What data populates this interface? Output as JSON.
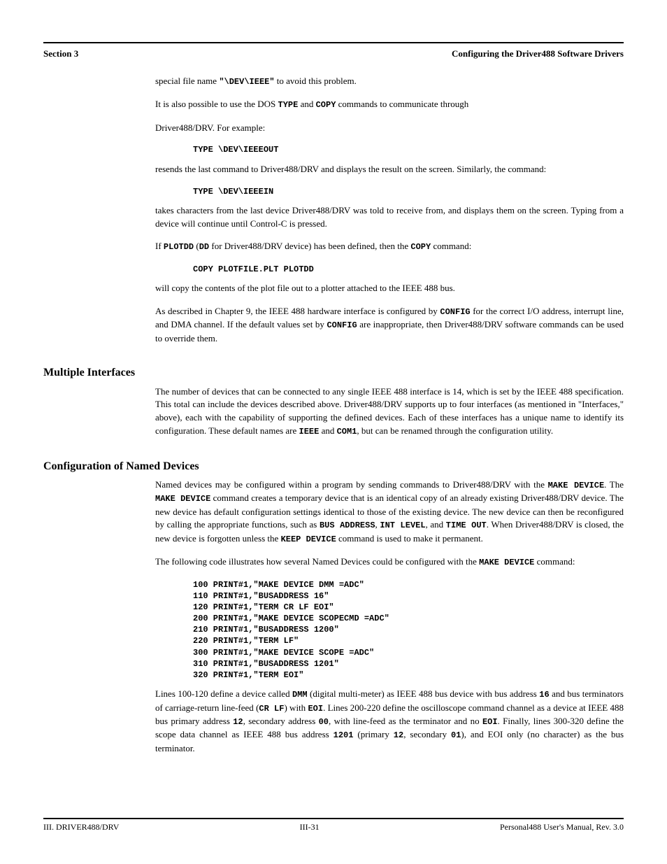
{
  "header": {
    "left": "Section 3",
    "right": "Configuring the Driver488 Software Drivers"
  },
  "p1": {
    "t1": "special file name ",
    "m1": "\"\\DEV\\IEEE\"",
    "t2": " to avoid this problem."
  },
  "p2": {
    "t1": "It is also possible to use the DOS ",
    "m1": "TYPE",
    "t2": " and ",
    "m2": "COPY",
    "t3": " commands to communicate through"
  },
  "p3": "Driver488/DRV. For example:",
  "code1": "TYPE \\DEV\\IEEEOUT",
  "p4": "resends the last command to Driver488/DRV and displays the result on the screen. Similarly, the command:",
  "code2": "TYPE \\DEV\\IEEEIN",
  "p5": "takes characters from the last device Driver488/DRV was told to receive from, and displays them on the screen. Typing from a device will continue until Control-C is pressed.",
  "p6": {
    "t1": "If ",
    "m1": "PLOTDD",
    "t2": " (",
    "m2": "DD",
    "t3": " for Driver488/DRV device) has been defined, then the ",
    "m3": "COPY",
    "t4": " command:"
  },
  "code3": "COPY PLOTFILE.PLT PLOTDD",
  "p7": "will copy the contents of the plot file out to a plotter attached to the IEEE 488 bus.",
  "p8": {
    "t1": "As described in Chapter 9, the IEEE 488 hardware interface is configured by ",
    "m1": "CONFIG",
    "t2": " for the correct I/O address, interrupt line, and DMA channel. If the default values set by ",
    "m2": "CONFIG",
    "t3": " are inappropriate, then Driver488/DRV software commands can be used to override them."
  },
  "h3": "Multiple Interfaces",
  "p9": {
    "t1": "The number of devices that can be connected to any single IEEE 488 interface is 14, which is set by the IEEE 488 specification. This total can include the devices described above. Driver488/DRV supports up to four interfaces (as mentioned in \"Interfaces,\" above), each with the capability of supporting the defined devices. Each of these interfaces has a unique name to identify its configuration. These default names are ",
    "m1": "IEEE",
    "t2": " and ",
    "m2": "COM1",
    "t3": ", but can be renamed through the configuration utility."
  },
  "h4": "Configuration of Named Devices",
  "p10": {
    "t1": "Named devices may be configured within a program by sending commands to Driver488/DRV with the ",
    "m1": "MAKE DEVICE",
    "t2": ". The ",
    "m2": "MAKE DEVICE",
    "t3": " command creates a temporary device that is an identical copy of an already existing Driver488/DRV device. The new device has default configuration settings identical to those of the existing device. The new device can then be reconfigured by calling the appropriate functions, such as ",
    "m3": "BUS ADDRESS",
    "t4": ", ",
    "m4": "INT LEVEL",
    "t5": ", and ",
    "m5": "TIME OUT",
    "t6": ". When Driver488/DRV is closed, the new device is forgotten unless the ",
    "m6": "KEEP DEVICE",
    "t7": " command is used to make it permanent."
  },
  "p11": {
    "t1": "The following code illustrates how several Named Devices could be configured with the ",
    "m1": "MAKE DEVICE",
    "t2": " command:"
  },
  "code4": "100 PRINT#1,\"MAKE DEVICE DMM =ADC\"\n110 PRINT#1,\"BUSADDRESS 16\"\n120 PRINT#1,\"TERM CR LF EOI\"\n200 PRINT#1,\"MAKE DEVICE SCOPECMD =ADC\"\n210 PRINT#1,\"BUSADDRESS 1200\"\n220 PRINT#1,\"TERM LF\"\n300 PRINT#1,\"MAKE DEVICE SCOPE =ADC\"\n310 PRINT#1,\"BUSADDRESS 1201\"\n320 PRINT#1,\"TERM EOI\"",
  "p12": {
    "t1": "Lines 100-120 define a device called ",
    "m1": "DMM",
    "t2": " (digital multi-meter) as IEEE 488 bus device with bus address ",
    "m2": "16",
    "t3": " and bus terminators of carriage-return line-feed (",
    "m3": "CR LF",
    "t4": ") with ",
    "m4": "EOI",
    "t5": ". Lines 200-220 define the oscilloscope command channel as a device at IEEE 488 bus primary address ",
    "m5": "12",
    "t6": ", secondary address ",
    "m6": "00",
    "t7": ", with line-feed as the terminator and no ",
    "m7": "EOI",
    "t8": ". Finally, lines 300-320 define the scope data channel as IEEE 488 bus address ",
    "m8": "1201",
    "t9": " (primary ",
    "m9": "12",
    "t10": ", secondary ",
    "m10": "01",
    "t11": "), and EOI only (no character) as the bus terminator."
  },
  "footer": {
    "left": "III. DRIVER488/DRV",
    "center": "III-31",
    "right": "Personal488 User's Manual, Rev. 3.0"
  }
}
